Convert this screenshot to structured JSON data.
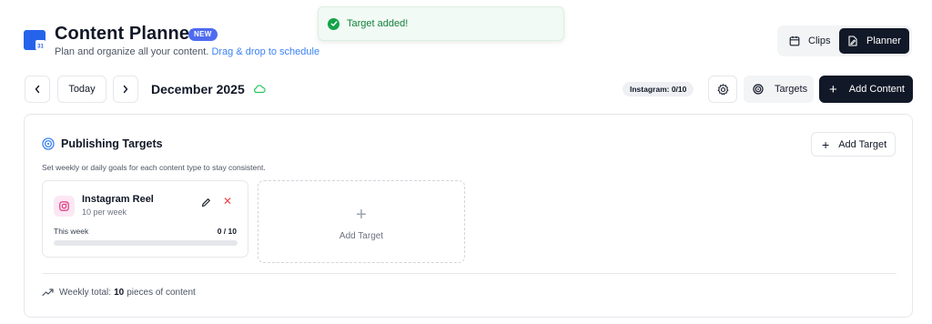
{
  "header": {
    "title": "Content Planner",
    "badge": "NEW",
    "subtitle_text": "Plan and organize all your content.",
    "subtitle_link": "Drag & drop to schedule",
    "app_icon_day": "31"
  },
  "toast": {
    "message": "Target added!"
  },
  "view_toggle": {
    "clips_label": "Clips",
    "planner_label": "Planner",
    "active": "Planner"
  },
  "toolbar": {
    "today_label": "Today",
    "month": "December 2025",
    "instagram_count": "Instagram: 0/10",
    "targets_label": "Targets",
    "add_content_label": "Add Content",
    "plus": "+"
  },
  "targets_panel": {
    "title": "Publishing Targets",
    "description": "Set weekly or daily goals for each content type to stay consistent.",
    "add_target_label": "Add Target",
    "cards": [
      {
        "name": "Instagram Reel",
        "frequency": "10 per week",
        "period_label": "This week",
        "progress_text": "0 / 10",
        "progress_fraction": 0
      }
    ],
    "add_card_label": "Add Target",
    "weekly_total_prefix": "Weekly total:",
    "weekly_total_count": "10",
    "weekly_total_suffix": "pieces of content"
  },
  "icons": {
    "app": "calendar-app-icon",
    "toast": "check-circle-icon",
    "clips": "calendar-icon",
    "planner": "edit-document-icon",
    "prev": "chevron-left-icon",
    "next": "chevron-right-icon",
    "cloud": "cloud-icon",
    "settings": "gear-icon",
    "targets": "target-icon",
    "instagram": "instagram-icon",
    "edit": "pencil-icon",
    "delete": "close-icon",
    "trend": "trending-up-icon"
  },
  "colors": {
    "accent_blue": "#3b82f6",
    "badge_blue": "#4f6bf0",
    "dark": "#111827",
    "success": "#16a34a",
    "danger": "#ef4444",
    "instagram_pink": "#db2777"
  }
}
